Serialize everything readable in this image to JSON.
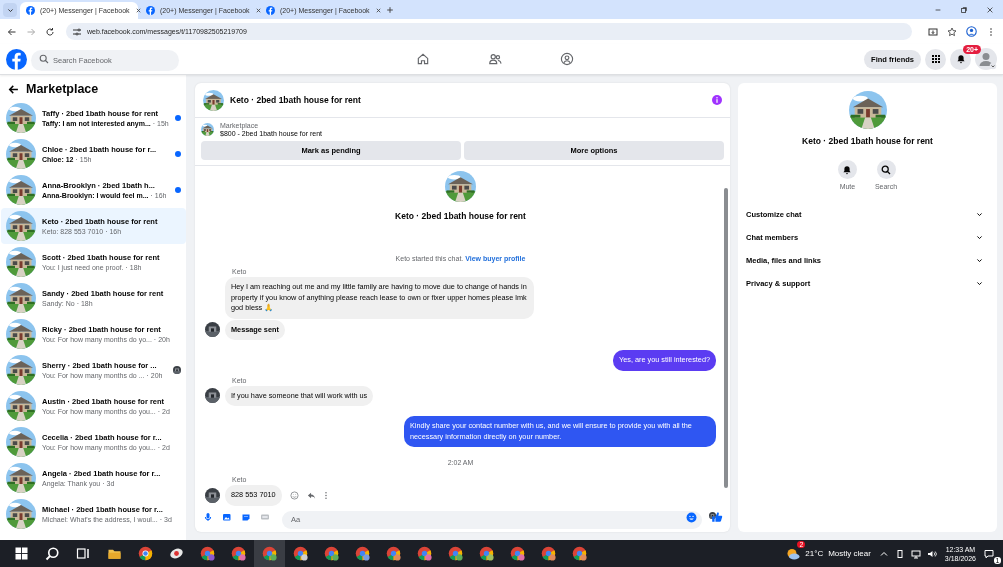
{
  "browser": {
    "tabs": [
      {
        "title": "(20+) Messenger | Facebook",
        "selected": true
      },
      {
        "title": "(20+) Messenger | Facebook",
        "selected": false
      },
      {
        "title": "(20+) Messenger | Facebook",
        "selected": false
      }
    ],
    "url": "web.facebook.com/messages/t/1170982505219709"
  },
  "header": {
    "search_placeholder": "Search Facebook",
    "find_friends": "Find friends",
    "notification_badge": "20+"
  },
  "sidebar": {
    "title": "Marketplace",
    "conversations": [
      {
        "title": "Taffy · 2bed 1bath house for rent",
        "snippet": "Taffy: I am not interested anym...",
        "time": "· 15h",
        "unread": true,
        "seen": false,
        "selected": false
      },
      {
        "title": "Chloe · 2bed 1bath house for r...",
        "snippet": "Chloe: 12",
        "time": "· 15h",
        "unread": true,
        "seen": false,
        "selected": false
      },
      {
        "title": "Anna-Brooklyn · 2bed 1bath h...",
        "snippet": "Anna-Brooklyn: I would feel m...",
        "time": "· 16h",
        "unread": true,
        "seen": false,
        "selected": false
      },
      {
        "title": "Keto · 2bed 1bath house for rent",
        "snippet": "Keto: 828 553 7010",
        "time": "· 16h",
        "unread": false,
        "seen": false,
        "selected": true
      },
      {
        "title": "Scott · 2bed 1bath house for rent",
        "snippet": "You: I just need one proof.",
        "time": "· 18h",
        "unread": false,
        "seen": false,
        "selected": false
      },
      {
        "title": "Sandy · 2bed 1bath house for rent",
        "snippet": "Sandy: No",
        "time": "· 18h",
        "unread": false,
        "seen": false,
        "selected": false
      },
      {
        "title": "Ricky · 2bed 1bath house for rent",
        "snippet": "You: For how many months do yo...",
        "time": "· 20h",
        "unread": false,
        "seen": false,
        "selected": false
      },
      {
        "title": "Sherry · 2bed 1bath house for ...",
        "snippet": "You: For how many months do ...",
        "time": "· 20h",
        "unread": false,
        "seen": true,
        "selected": false
      },
      {
        "title": "Austin · 2bed 1bath house for rent",
        "snippet": "You: For how many months do you...",
        "time": "· 2d",
        "unread": false,
        "seen": false,
        "selected": false
      },
      {
        "title": "Cecelia · 2bed 1bath house for r...",
        "snippet": "You: For how many months do you...",
        "time": "· 2d",
        "unread": false,
        "seen": false,
        "selected": false
      },
      {
        "title": "Angela · 2bed 1bath house for r...",
        "snippet": "Angela: Thank you",
        "time": "· 3d",
        "unread": false,
        "seen": false,
        "selected": false
      },
      {
        "title": "Michael · 2bed 1bath house for r...",
        "snippet": "Michael: What's the address, I woul...",
        "time": "· 3d",
        "unread": false,
        "seen": false,
        "selected": false
      }
    ]
  },
  "chat": {
    "title": "Keto · 2bed 1bath house for rent",
    "listing": {
      "label": "Marketplace",
      "price_title": "$800 - 2bed 1bath house for rent"
    },
    "buttons": [
      "Mark as pending",
      "More options"
    ],
    "intro": {
      "title": "Keto · 2bed 1bath house for rent",
      "note": "Keto started this chat.",
      "link": "View buyer profile"
    },
    "messages": [
      {
        "kind": "incoming",
        "sender": "Keto",
        "text": "Hey I am reaching out me and my little family are having to move due to change of hands in property if you know of anything please reach lease to own or fixer upper homes please lmk god bless 🙏",
        "bold": false,
        "avatar": false,
        "actions": false
      },
      {
        "kind": "incoming",
        "text": "Message sent",
        "bold": true,
        "avatar": true,
        "actions": false
      },
      {
        "kind": "outgoing",
        "text": "Yes, are you still interested?",
        "color": "#5b3cf2"
      },
      {
        "kind": "incoming",
        "sender": "Keto",
        "text": "If you have someone that will work with us",
        "bold": false,
        "avatar": true,
        "actions": false
      },
      {
        "kind": "outgoing",
        "text": "Kindly share your contact number with us, and we will ensure to provide you with all the necessary information directly on your number.",
        "color": "#2f56f2"
      },
      {
        "kind": "timestamp",
        "text": "2:02 AM"
      },
      {
        "kind": "incoming",
        "sender": "Keto",
        "text": "828 553 7010",
        "bold": false,
        "avatar": true,
        "actions": true
      }
    ],
    "composer_placeholder": "Aa"
  },
  "details": {
    "title": "Keto · 2bed 1bath house for rent",
    "actions": [
      {
        "kind": "mute",
        "label": "Mute"
      },
      {
        "kind": "search",
        "label": "Search"
      }
    ],
    "sections": [
      "Customize chat",
      "Chat members",
      "Media, files and links",
      "Privacy & support"
    ]
  },
  "taskbar": {
    "weather_badge": "2",
    "temperature": "21°C",
    "condition": "Mostly clear",
    "time": "12:33 AM",
    "date": "3/18/2026",
    "notifications": "1"
  }
}
